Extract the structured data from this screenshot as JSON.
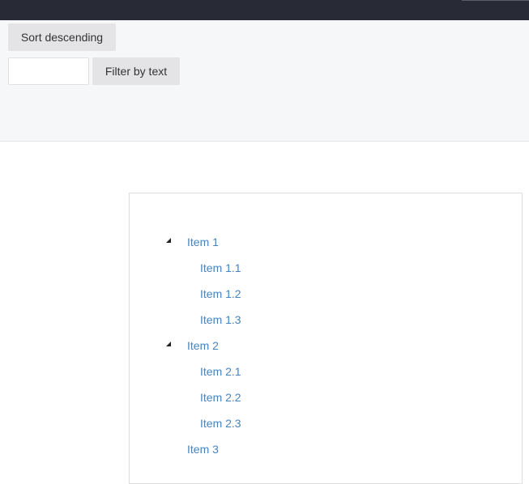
{
  "toolbar": {
    "sort_label": "Sort descending",
    "filter_input_value": "",
    "filter_input_placeholder": "",
    "filter_label": "Filter by text"
  },
  "tree": {
    "items": [
      {
        "label": "Item 1",
        "level": 1,
        "expanded": true
      },
      {
        "label": "Item 1.1",
        "level": 2
      },
      {
        "label": "Item 1.2",
        "level": 2
      },
      {
        "label": "Item 1.3",
        "level": 2
      },
      {
        "label": "Item 2",
        "level": 1,
        "expanded": true
      },
      {
        "label": "Item 2.1",
        "level": 2
      },
      {
        "label": "Item 2.2",
        "level": 2
      },
      {
        "label": "Item 2.3",
        "level": 2
      },
      {
        "label": "Item 3",
        "level": 1,
        "expanded": false
      }
    ]
  },
  "colors": {
    "topbar": "#282a36",
    "toolbar_bg": "#f6f7f9",
    "button_bg": "#e4e4e7",
    "link": "#4a82b8",
    "toggle": "#222222"
  }
}
